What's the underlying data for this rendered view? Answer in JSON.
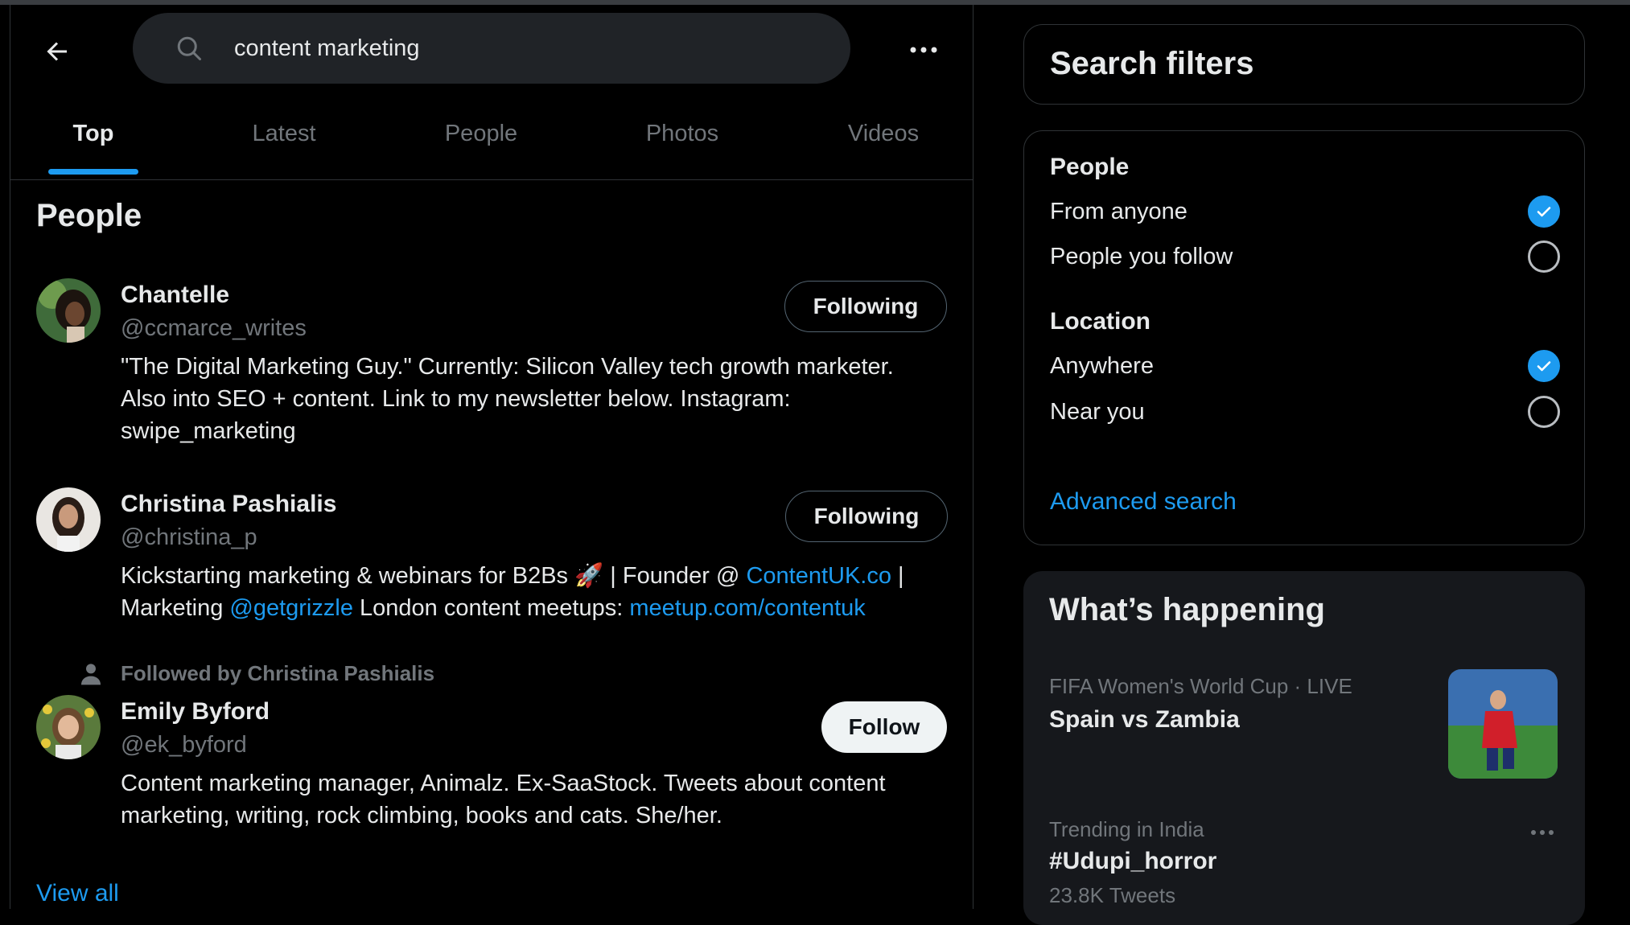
{
  "search": {
    "query": "content marketing"
  },
  "tabs": [
    {
      "label": "Top",
      "active": true
    },
    {
      "label": "Latest",
      "active": false
    },
    {
      "label": "People",
      "active": false
    },
    {
      "label": "Photos",
      "active": false
    },
    {
      "label": "Videos",
      "active": false
    }
  ],
  "people_section": {
    "title": "People",
    "view_all": "View all",
    "people": [
      {
        "name": "Chantelle",
        "handle": "@ccmarce_writes",
        "button": "Following",
        "bio_line1": "\"The Digital Marketing Guy.\" Currently: Silicon Valley tech growth marketer.",
        "bio_line2": "Also into SEO + content. Link to my newsletter below. Instagram:",
        "bio_line3": "swipe_marketing"
      },
      {
        "name": "Christina Pashialis",
        "handle": "@christina_p",
        "button": "Following",
        "bio_a": "Kickstarting marketing & webinars for B2Bs 🚀 | Founder @ ",
        "bio_link1": "ContentUK.co",
        "bio_b": " |",
        "bio_c": "Marketing ",
        "bio_link2": "@getgrizzle",
        "bio_d": " London content meetups: ",
        "bio_link3": "meetup.com/contentuk"
      },
      {
        "context": "Followed by Christina Pashialis",
        "name": "Emily Byford",
        "handle": "@ek_byford",
        "button": "Follow",
        "bio_line1": "Content marketing manager, Animalz. Ex-SaaStock. Tweets about content",
        "bio_line2": "marketing, writing, rock climbing, books and cats. She/her."
      }
    ]
  },
  "search_filters": {
    "title": "Search filters",
    "people_heading": "People",
    "people_options": [
      {
        "label": "From anyone",
        "checked": true
      },
      {
        "label": "People you follow",
        "checked": false
      }
    ],
    "location_heading": "Location",
    "location_options": [
      {
        "label": "Anywhere",
        "checked": true
      },
      {
        "label": "Near you",
        "checked": false
      }
    ],
    "advanced": "Advanced search"
  },
  "whats_happening": {
    "title": "What’s happening",
    "trends": [
      {
        "meta": "FIFA Women's World Cup · LIVE",
        "name": "Spain vs Zambia"
      },
      {
        "meta": "Trending in India",
        "name": "#Udupi_horror",
        "count": "23.8K Tweets"
      }
    ]
  },
  "colors": {
    "accent": "#1d9bf0",
    "background": "#000000",
    "card": "#16181c",
    "muted": "#71767b"
  }
}
